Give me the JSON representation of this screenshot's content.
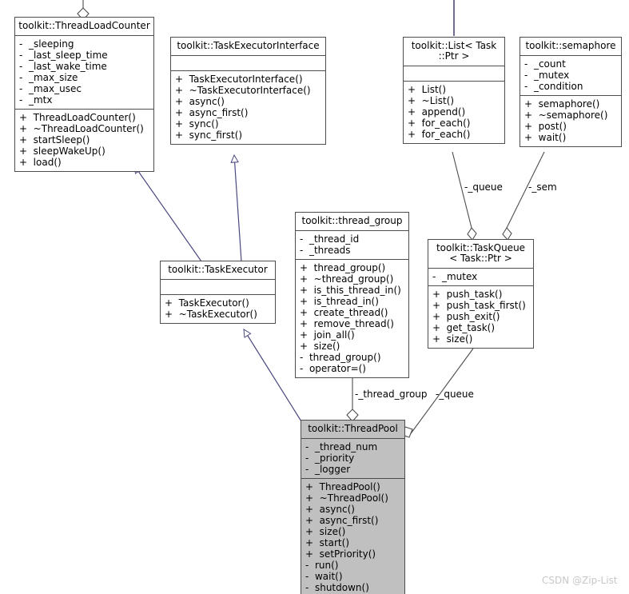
{
  "diagram": {
    "title": "toolkit ThreadPool UML class diagram",
    "watermark": "CSDN @Zip-List",
    "colors": {
      "inheritance_edge": "#49497f",
      "association_edge": "#4d4d4d",
      "box_border": "#4d4d4d",
      "box_fill": "#ffffff",
      "highlight_fill": "#c0c0c0",
      "text": "#000000",
      "watermark": "#c8c8c8"
    }
  },
  "classes": {
    "thread_load_counter": {
      "title": "toolkit::ThreadLoadCounter",
      "attributes": [
        "-  _sleeping",
        "-  _last_sleep_time",
        "-  _last_wake_time",
        "-  _max_size",
        "-  _max_usec",
        "-  _mtx"
      ],
      "operations": [
        "+  ThreadLoadCounter()",
        "+  ~ThreadLoadCounter()",
        "+  startSleep()",
        "+  sleepWakeUp()",
        "+  load()"
      ]
    },
    "task_executor_interface": {
      "title": "toolkit::TaskExecutorInterface",
      "attributes": [],
      "operations": [
        "+  TaskExecutorInterface()",
        "+  ~TaskExecutorInterface()",
        "+  async()",
        "+  async_first()",
        "+  sync()",
        "+  sync_first()"
      ]
    },
    "list": {
      "title": "toolkit::List< Task\n::Ptr >",
      "attributes": [],
      "operations": [
        "+  List()",
        "+  ~List()",
        "+  append()",
        "+  for_each()",
        "+  for_each()"
      ]
    },
    "semaphore": {
      "title": "toolkit::semaphore",
      "attributes": [
        "-  _count",
        "-  _mutex",
        "-  _condition"
      ],
      "operations": [
        "+  semaphore()",
        "+  ~semaphore()",
        "+  post()",
        "+  wait()"
      ]
    },
    "task_executor": {
      "title": "toolkit::TaskExecutor",
      "attributes": [],
      "operations": [
        "+  TaskExecutor()",
        "+  ~TaskExecutor()"
      ]
    },
    "thread_group": {
      "title": "toolkit::thread_group",
      "attributes": [
        "-  _thread_id",
        "-  _threads"
      ],
      "operations": [
        "+  thread_group()",
        "+  ~thread_group()",
        "+  is_this_thread_in()",
        "+  is_thread_in()",
        "+  create_thread()",
        "+  remove_thread()",
        "+  join_all()",
        "+  size()",
        "-  thread_group()",
        "-  operator=()"
      ]
    },
    "task_queue": {
      "title": "toolkit::TaskQueue\n< Task::Ptr >",
      "attributes": [
        "-  _mutex"
      ],
      "operations": [
        "+  push_task()",
        "+  push_task_first()",
        "+  push_exit()",
        "+  get_task()",
        "+  size()"
      ]
    },
    "thread_pool": {
      "title": "toolkit::ThreadPool",
      "attributes": [
        "-  _thread_num",
        "-  _priority",
        "-  _logger"
      ],
      "operations": [
        "+  ThreadPool()",
        "+  ~ThreadPool()",
        "+  async()",
        "+  async_first()",
        "+  size()",
        "+  start()",
        "+  setPriority()",
        "-  run()",
        "-  wait()",
        "-  shutdown()"
      ]
    }
  },
  "edge_labels": {
    "queue_top": "-_queue",
    "sem": "-_sem",
    "thread_group": "-_thread_group",
    "queue_bottom": "-_queue"
  }
}
